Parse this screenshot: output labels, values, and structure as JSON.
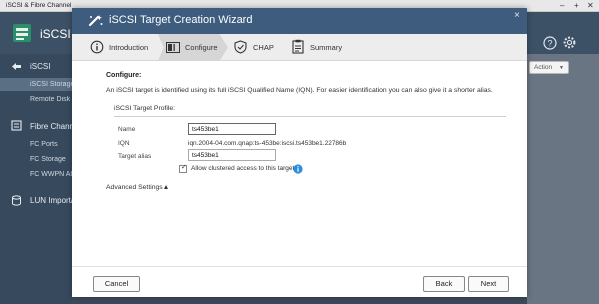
{
  "app": {
    "window_title": "iSCSI & Fibre Channel",
    "name": "iSCSI",
    "window_controls": [
      "–",
      "+",
      "✕"
    ]
  },
  "sidebar": {
    "items": [
      {
        "label": "iSCSI",
        "kind": "section"
      },
      {
        "label": "iSCSI Storage",
        "kind": "sub",
        "active": true
      },
      {
        "label": "Remote Disk",
        "kind": "sub"
      },
      {
        "label": "Fibre Channel",
        "kind": "section"
      },
      {
        "label": "FC Ports",
        "kind": "sub"
      },
      {
        "label": "FC Storage",
        "kind": "sub"
      },
      {
        "label": "FC WWPN Al",
        "kind": "sub"
      },
      {
        "label": "LUN Import/",
        "kind": "section"
      }
    ]
  },
  "toolbar": {
    "action_label": "Action"
  },
  "wizard": {
    "title": "iSCSI Target Creation Wizard",
    "close_glyph": "×",
    "steps": [
      {
        "label": "Introduction",
        "icon": "info-circle-icon"
      },
      {
        "label": "Configure",
        "icon": "configure-icon",
        "active": true
      },
      {
        "label": "CHAP",
        "icon": "shield-check-icon"
      },
      {
        "label": "Summary",
        "icon": "clipboard-icon"
      }
    ],
    "configure": {
      "heading": "Configure:",
      "description": "An iSCSI target is identified using its full iSCSI Qualified Name (IQN). For easier identification you can also give it a shorter alias.",
      "profile_title": "iSCSI Target Profile:",
      "name_label": "Name",
      "name_value": "ts453be1",
      "iqn_label": "IQN",
      "iqn_value": "iqn.2004-04.com.qnap:ts-453be:iscsi.ts453be1.22786b",
      "alias_label": "Target alias",
      "alias_value": "ts453be1",
      "cluster_label": "Allow clustered access to this target",
      "cluster_checked": true,
      "advanced_label": "Advanced Settings▲"
    },
    "buttons": {
      "cancel": "Cancel",
      "back": "Back",
      "next": "Next"
    }
  },
  "colors": {
    "header_bg": "#3d5166",
    "sidebar_bg": "#37495d",
    "modal_header_bg": "#3d5c7e",
    "info_blue": "#2a8fe0"
  }
}
